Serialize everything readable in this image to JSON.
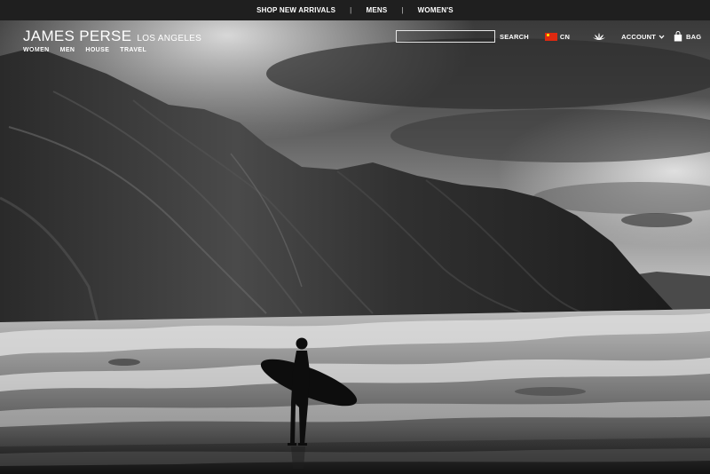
{
  "promo_bar": {
    "links": [
      "SHOP NEW ARRIVALS",
      "MENS",
      "WOMEN'S"
    ],
    "separator": "|"
  },
  "brand": {
    "name": "JAMES PERSE",
    "location": "LOS ANGELES"
  },
  "main_nav": [
    "WOMEN",
    "MEN",
    "HOUSE",
    "TRAVEL"
  ],
  "utility": {
    "search_value": "",
    "search_label": "SEARCH",
    "country": "CN",
    "flag_icon": "china-flag-icon",
    "lotus_icon": "lotus-icon",
    "account_label": "ACCOUNT",
    "bag_label": "BAG"
  },
  "colors": {
    "topbar_bg": "#1f1f1f",
    "text": "#ffffff",
    "flag_red": "#de2910",
    "flag_yellow": "#ffde00"
  }
}
